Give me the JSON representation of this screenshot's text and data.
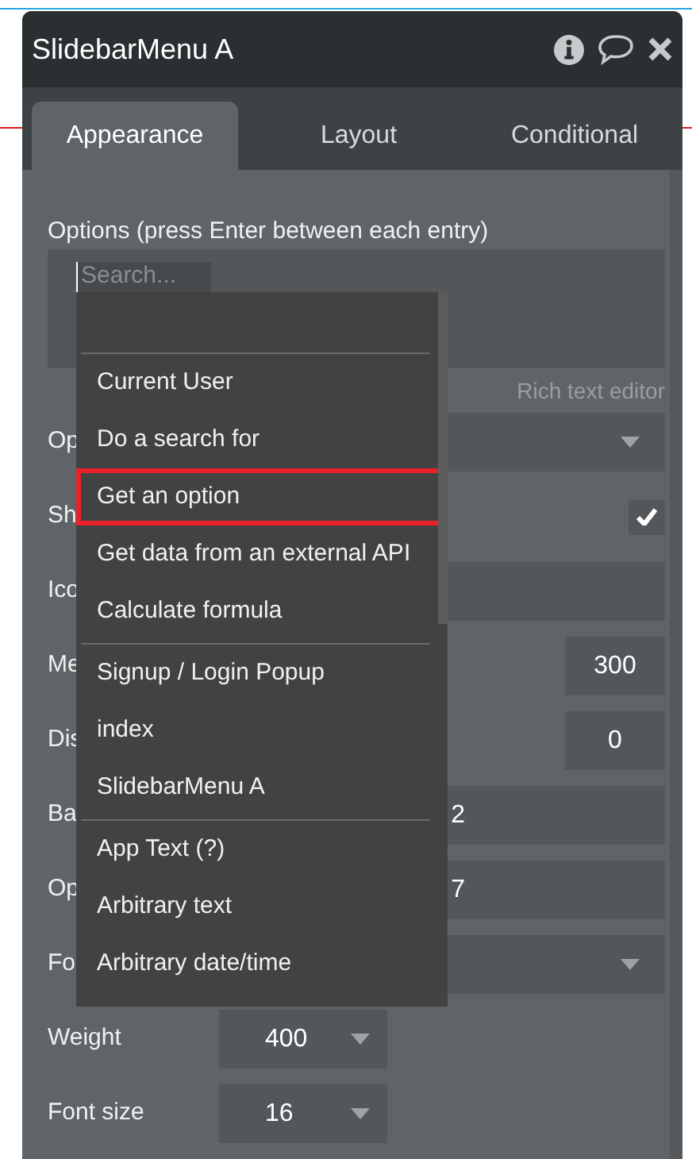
{
  "window": {
    "title": "SlidebarMenu A"
  },
  "tabs": [
    {
      "label": "Appearance",
      "selected": true
    },
    {
      "label": "Layout",
      "selected": false
    },
    {
      "label": "Conditional",
      "selected": false
    }
  ],
  "options": {
    "label": "Options (press Enter between each entry)",
    "search": {
      "placeholder": "Search..."
    },
    "link": "Rich text editor"
  },
  "rows": [
    {
      "kind": "select",
      "label": "Op"
    },
    {
      "kind": "checkbox",
      "label": "Sh",
      "checked": true
    },
    {
      "kind": "text",
      "label": "Ico"
    },
    {
      "kind": "small",
      "label": "Me",
      "value": "300"
    },
    {
      "kind": "small",
      "label": "Dis",
      "value": "0"
    },
    {
      "kind": "text",
      "label": "Ba",
      "value": "2"
    },
    {
      "kind": "text",
      "label": "Op",
      "value": "7"
    },
    {
      "kind": "select",
      "label": "Fo"
    },
    {
      "kind": "dropdown",
      "label": "Weight",
      "value": "400"
    },
    {
      "kind": "dropdown",
      "label": "Font size",
      "value": "16"
    }
  ],
  "menu": {
    "groups": [
      [
        {
          "label": "Current User",
          "highlighted": false
        },
        {
          "label": "Do a search for",
          "highlighted": false
        },
        {
          "label": "Get an option",
          "highlighted": true
        },
        {
          "label": "Get data from an external API",
          "highlighted": false
        },
        {
          "label": "Calculate formula",
          "highlighted": false
        }
      ],
      [
        {
          "label": "Signup / Login Popup",
          "highlighted": false
        },
        {
          "label": "index",
          "highlighted": false
        },
        {
          "label": "SlidebarMenu A",
          "highlighted": false
        }
      ],
      [
        {
          "label": "App Text (?)",
          "highlighted": false
        },
        {
          "label": "Arbitrary text",
          "highlighted": false
        },
        {
          "label": "Arbitrary date/time",
          "highlighted": false
        }
      ]
    ]
  }
}
